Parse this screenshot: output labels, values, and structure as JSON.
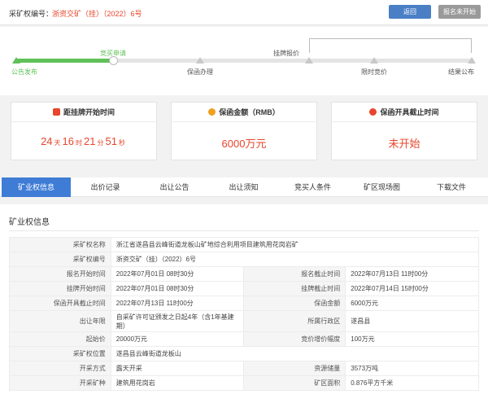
{
  "header": {
    "label": "采矿权编号：",
    "code": "浙资交矿（挂）（2022）6号",
    "back_button": "返回",
    "signup_button": "报名未开始"
  },
  "progress": {
    "fill_fraction": 0.21,
    "steps": [
      "公告发布",
      "竞买申请",
      "保函办理",
      "挂牌报价",
      "限时竞价",
      "结果公布"
    ]
  },
  "cards": [
    {
      "title": "距挂牌开始时间",
      "icon": "alarm-icon",
      "color": "#e8452c",
      "countdown": {
        "days": "24",
        "days_unit": "天",
        "hours": "16",
        "hours_unit": "时",
        "minutes": "21",
        "minutes_unit": "分",
        "seconds": "51",
        "seconds_unit": "秒"
      }
    },
    {
      "title": "保函金额（RMB）",
      "icon": "coin-icon",
      "color": "#f0a020",
      "value": "6000万元"
    },
    {
      "title": "保函开具截止时间",
      "icon": "alarm-clock-icon",
      "color": "#e8452c",
      "value": "未开始"
    }
  ],
  "tabs": [
    "矿业权信息",
    "出价记录",
    "出让公告",
    "出让须知",
    "竞买人条件",
    "矿区现场图",
    "下载文件"
  ],
  "section": {
    "title": "矿业权信息",
    "rows": [
      {
        "type": "full",
        "k": "采矿权名称",
        "v": "浙江省遂昌县云峰街道龙板山矿地综合利用项目建筑用花岗岩矿"
      },
      {
        "type": "full",
        "k": "采矿权编号",
        "v": "浙资交矿（挂）（2022）6号"
      },
      {
        "type": "pair",
        "k1": "报名开始时间",
        "v1": "2022年07月01日 08时30分",
        "k2": "报名截止时间",
        "v2": "2022年07月13日 11时00分"
      },
      {
        "type": "pair",
        "k1": "挂牌开始时间",
        "v1": "2022年07月01日 08时30分",
        "k2": "挂牌截止时间",
        "v2": "2022年07月14日 15时00分"
      },
      {
        "type": "pair",
        "k1": "保函开具截止时间",
        "v1": "2022年07月13日 11时00分",
        "k2": "保函金额",
        "v2": "6000万元"
      },
      {
        "type": "pair",
        "tall": true,
        "k1": "出让年限",
        "v1": "自采矿许可证颁发之日起4年（含1年基建期）",
        "k2": "所属行政区",
        "v2": "遂昌县"
      },
      {
        "type": "pair",
        "k1": "起始价",
        "v1": "20000万元",
        "k2": "竞价增价幅度",
        "v2": "100万元"
      },
      {
        "type": "full",
        "k": "采矿权位置",
        "v": "遂昌县云峰街道龙板山"
      },
      {
        "type": "pair",
        "k1": "开采方式",
        "v1": "露天开采",
        "k2": "资源储量",
        "v2": "3573万吨"
      },
      {
        "type": "pair",
        "k1": "开采矿种",
        "v1": "建筑用花岗岩",
        "k2": "矿区面积",
        "v2": "0.876平方千米"
      }
    ]
  }
}
